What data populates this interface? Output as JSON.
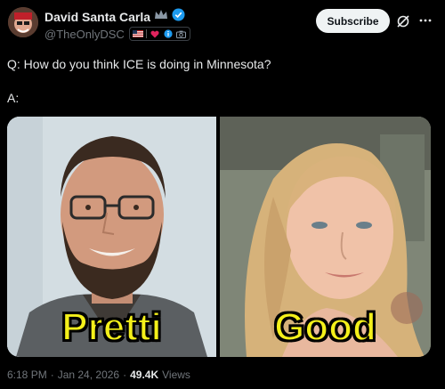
{
  "author": {
    "display_name": "David Santa Carla",
    "handle": "@TheOnlyDSC",
    "verified_color": "#1d9bf0"
  },
  "actions": {
    "subscribe_label": "Subscribe"
  },
  "tweet": {
    "question": "Q: How do you think ICE is doing in Minnesota?",
    "answer": "A:"
  },
  "media": {
    "left_caption": "Pretti",
    "right_caption": "Good",
    "caption_color": "#f4f01a"
  },
  "meta": {
    "time": "6:18 PM",
    "separator": "·",
    "date": "Jan 24, 2026",
    "separator2": "·",
    "views_count": "49.4K",
    "views_label": "Views"
  },
  "icons": [
    "avatar",
    "crown-icon",
    "verified-icon",
    "us-flag-icon",
    "heart-icon",
    "info-icon",
    "camera-icon",
    "grok-icon",
    "more-icon"
  ]
}
